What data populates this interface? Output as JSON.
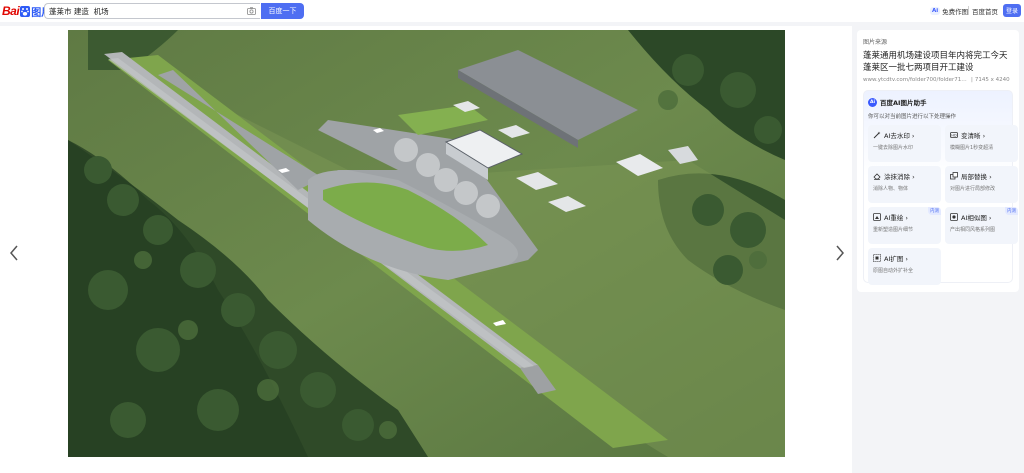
{
  "header": {
    "logo": {
      "bai": "Bai",
      "tu": "图片"
    },
    "search": {
      "value": "蓬莱市 建造  机场"
    },
    "search_button": "百度一下",
    "ai_button": {
      "badge": "Ai",
      "label": "免费作图"
    },
    "home_link": "百度首页",
    "login_button": "登录"
  },
  "viewer": {
    "prev_icon": "chevron-left-icon",
    "next_icon": "chevron-right-icon"
  },
  "source": {
    "label": "图片来源",
    "title": "蓬莱通用机场建设项目年内将完工今天蓬莱区一批七两项目开工建设",
    "url": "www.ytcdtv.com/folder700/folder717/fold...",
    "separator": "|",
    "dimensions": "7145 x 4240"
  },
  "assistant": {
    "logo": "Ai",
    "title": "百度AI图片助手",
    "description": "你可以对当前图片进行以下处理操作",
    "tools": [
      {
        "icon": "magic-wand-icon",
        "title": "AI去水印 ›",
        "desc": "一键去除图片水印",
        "badge": ""
      },
      {
        "icon": "hd-icon",
        "title": "变清晰 ›",
        "desc": "模糊图片1秒变超清",
        "badge": ""
      },
      {
        "icon": "eraser-icon",
        "title": "涂抹消除 ›",
        "desc": "消除人物、物体",
        "badge": ""
      },
      {
        "icon": "replace-icon",
        "title": "局部替换 ›",
        "desc": "对图片进行局部修改",
        "badge": ""
      },
      {
        "icon": "paint-icon",
        "title": "AI重绘 ›",
        "desc": "重新塑造图片细节",
        "badge": "内测"
      },
      {
        "icon": "similar-icon",
        "title": "AI相似图 ›",
        "desc": "产出相同风格系列图",
        "badge": "内测"
      },
      {
        "icon": "expand-icon",
        "title": "AI扩图 ›",
        "desc": "原图自动外扩补全",
        "badge": ""
      }
    ]
  },
  "colors": {
    "accent": "#4e6ef2",
    "logo_red": "#e10602"
  }
}
